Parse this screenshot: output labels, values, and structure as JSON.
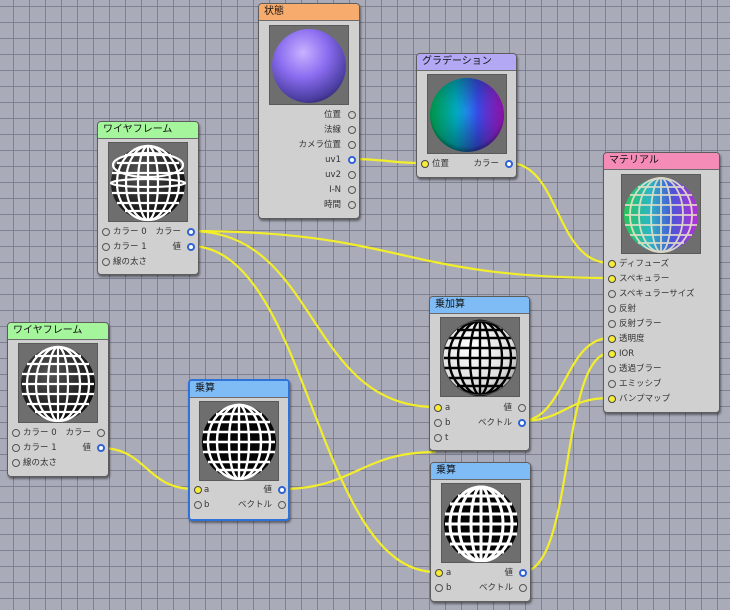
{
  "colors": {
    "wire": "#f3ee2a",
    "background": "#a9abb9",
    "grid": "#7f8190",
    "node_body": "#d0d0d0"
  },
  "nodes": {
    "state": {
      "title": "状態",
      "preview": "normal-sphere-preview",
      "outputs": [
        "位置",
        "法線",
        "カメラ位置",
        "uv1",
        "uv2",
        "I-N",
        "時間"
      ]
    },
    "gradient": {
      "title": "グラデーション",
      "preview": "gradient-sphere-preview",
      "input": "位置",
      "output": "カラー"
    },
    "wireframe_a": {
      "title": "ワイヤフレーム",
      "preview": "wireframe-sphere-preview",
      "color0": "カラー 0",
      "color1": "カラー 1",
      "line_width": "線の太さ",
      "out_color": "カラー",
      "out_value": "値"
    },
    "wireframe_b": {
      "title": "ワイヤフレーム",
      "preview": "wireframe-sphere-preview",
      "color0": "カラー 0",
      "color1": "カラー 1",
      "line_width": "線の太さ",
      "out_color": "カラー",
      "out_value": "値"
    },
    "multiply_a": {
      "title": "乗算",
      "preview": "wireframe-sphere-preview",
      "in_a": "a",
      "in_b": "b",
      "out_value": "値",
      "out_vector": "ベクトル"
    },
    "muladd": {
      "title": "乗加算",
      "preview": "wireframe-sphere-preview",
      "in_a": "a",
      "in_b": "b",
      "in_t": "t",
      "out_value": "値",
      "out_vector": "ベクトル"
    },
    "multiply_b": {
      "title": "乗算",
      "preview": "wireframe-sphere-preview",
      "in_a": "a",
      "in_b": "b",
      "out_value": "値",
      "out_vector": "ベクトル"
    },
    "material": {
      "title": "マテリアル",
      "preview": "material-sphere-preview",
      "inputs": [
        "ディフューズ",
        "スペキュラー",
        "スペキュラーサイズ",
        "反射",
        "反射ブラー",
        "透明度",
        "IOR",
        "透過ブラー",
        "エミッシブ",
        "バンプマップ"
      ]
    }
  }
}
